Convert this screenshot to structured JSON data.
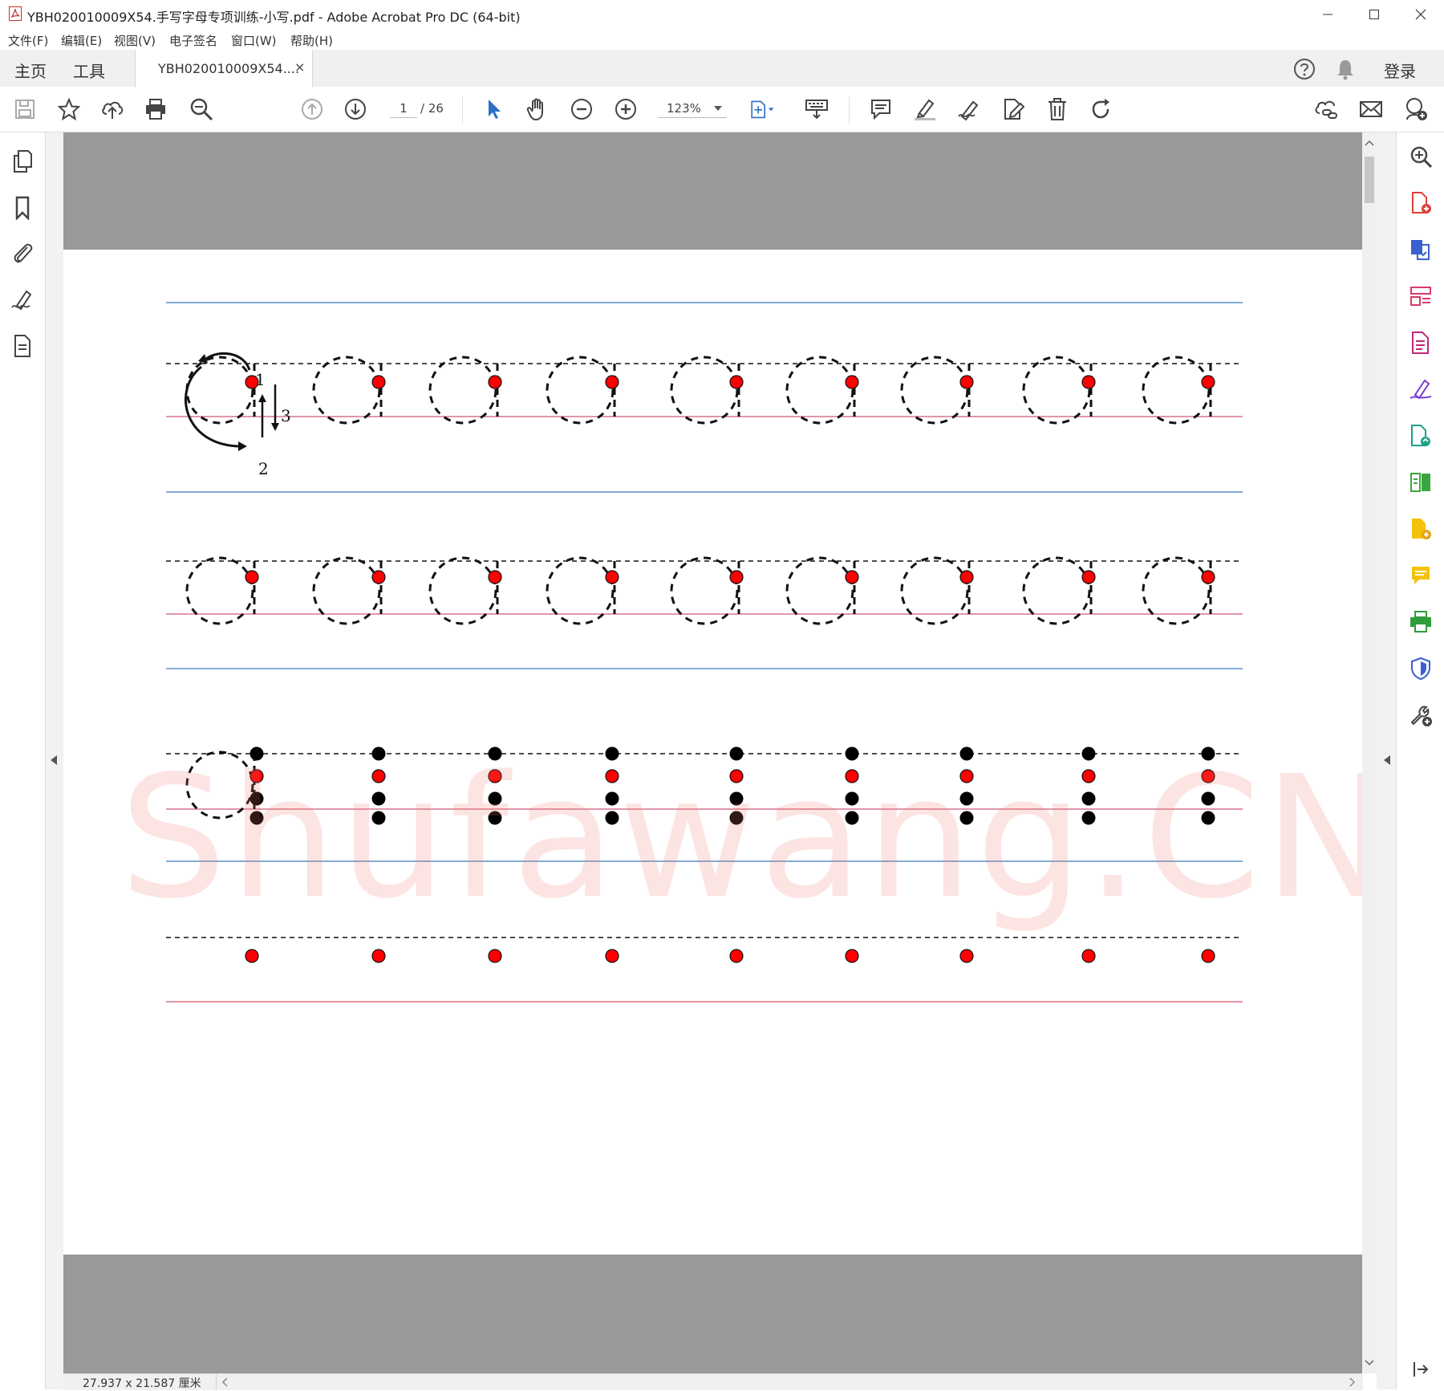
{
  "window": {
    "title": "YBH020010009X54.手写字母专项训练-小写.pdf - Adobe Acrobat Pro DC (64-bit)"
  },
  "menu": {
    "items": [
      "文件(F)",
      "编辑(E)",
      "视图(V)",
      "电子签名",
      "窗口(W)",
      "帮助(H)"
    ]
  },
  "tabs": {
    "home": "主页",
    "tools": "工具",
    "doc_tab": "YBH020010009X54....",
    "close_symbol": "×",
    "login": "登录"
  },
  "toolbar": {
    "current_page": "1",
    "total_pages": "/ 26",
    "zoom": "123%"
  },
  "status": {
    "page_size": "27.937 x 21.587 厘米"
  },
  "worksheet": {
    "stroke_labels": [
      "1",
      "2",
      "3"
    ],
    "rows": 4,
    "letters_per_row": 9,
    "colors": {
      "guide_top": "#5b8fc7",
      "guide_base": "#d9748a",
      "start_dot": "#ff0000",
      "dot": "#000000"
    }
  },
  "watermark": "Shufawang.CN"
}
